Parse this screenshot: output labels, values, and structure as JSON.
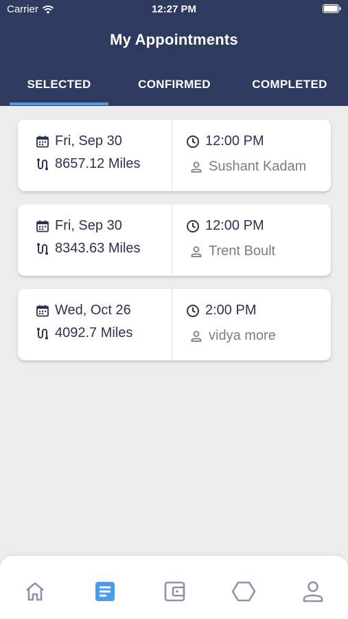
{
  "status_bar": {
    "carrier": "Carrier",
    "time": "12:27 PM"
  },
  "header": {
    "title": "My Appointments"
  },
  "tabs": [
    {
      "label": "SELECTED",
      "active": true
    },
    {
      "label": "CONFIRMED",
      "active": false
    },
    {
      "label": "COMPLETED",
      "active": false
    }
  ],
  "appointments": [
    {
      "date": "Fri, Sep 30",
      "distance": "8657.12 Miles",
      "time": "12:00 PM",
      "name": "Sushant Kadam"
    },
    {
      "date": "Fri, Sep 30",
      "distance": "8343.63 Miles",
      "time": "12:00 PM",
      "name": "Trent Boult"
    },
    {
      "date": "Wed, Oct 26",
      "distance": "4092.7 Miles",
      "time": "2:00 PM",
      "name": "vidya more"
    }
  ],
  "bottom_nav": [
    {
      "icon": "home-icon",
      "active": false
    },
    {
      "icon": "appointments-icon",
      "active": true
    },
    {
      "icon": "wallet-icon",
      "active": false
    },
    {
      "icon": "hexagon-icon",
      "active": false
    },
    {
      "icon": "profile-icon",
      "active": false
    }
  ],
  "colors": {
    "header": "#2e3a5e",
    "accent": "#4a9be8",
    "text": "#2b3350",
    "muted": "#7d7d80",
    "background": "#ececec"
  }
}
